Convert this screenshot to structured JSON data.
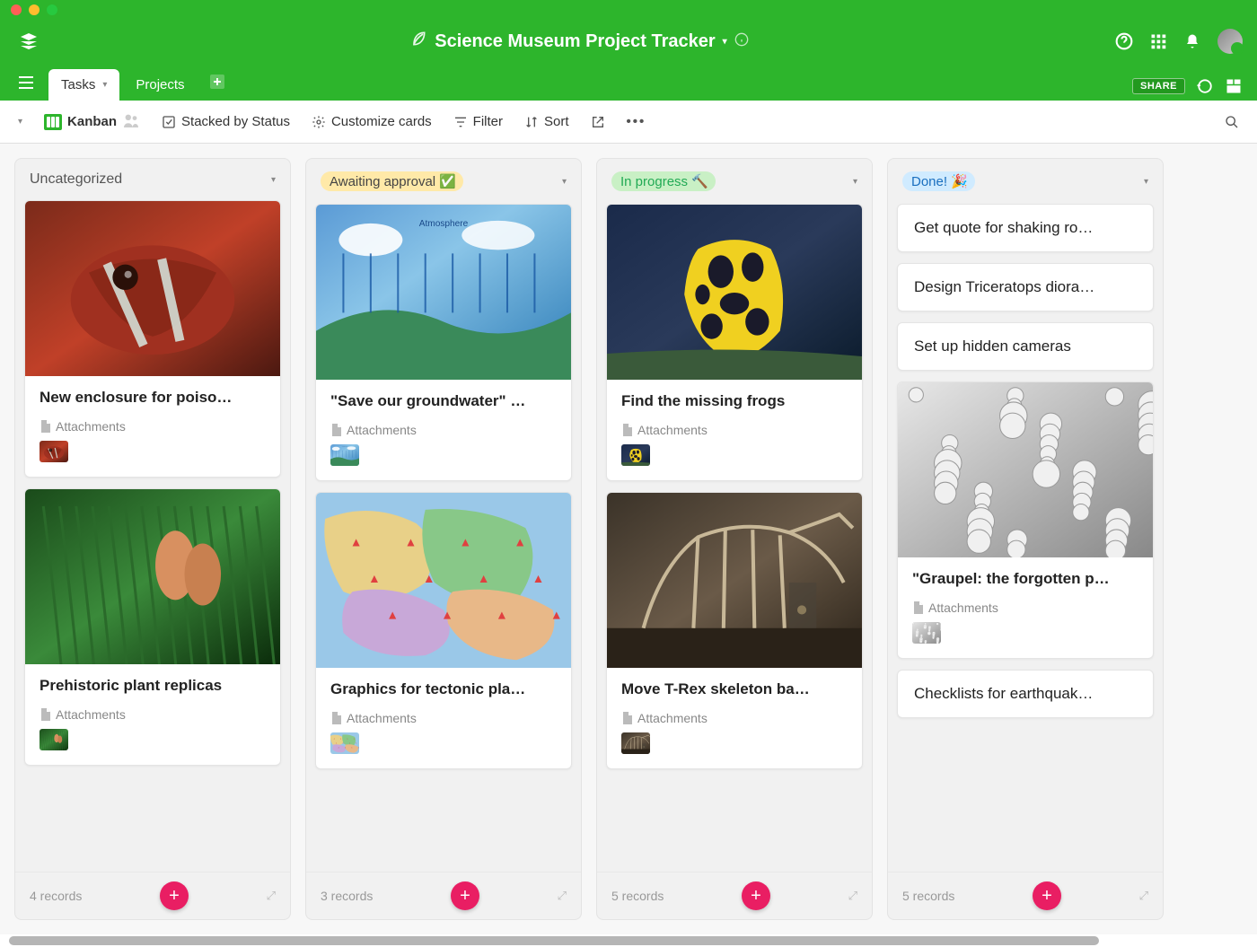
{
  "header": {
    "title": "Science Museum Project Tracker"
  },
  "tabs": {
    "active": "Tasks",
    "items": [
      "Tasks",
      "Projects"
    ]
  },
  "share_label": "SHARE",
  "toolbar": {
    "view_name": "Kanban",
    "stacked": "Stacked by Status",
    "customize": "Customize cards",
    "filter": "Filter",
    "sort": "Sort"
  },
  "attachments_label": "Attachments",
  "columns": [
    {
      "id": "uncat",
      "title": "Uncategorized",
      "pill": null,
      "record_count": "4 records",
      "cards": [
        {
          "title": "New enclosure for poiso…",
          "has_image": true,
          "has_attach": true,
          "img": "frog-red"
        },
        {
          "title": "Prehistoric plant replicas",
          "has_image": true,
          "has_attach": true,
          "img": "plant"
        }
      ]
    },
    {
      "id": "await",
      "title": "Awaiting approval",
      "emoji": "✅",
      "pill": "await",
      "record_count": "3 records",
      "cards": [
        {
          "title": "\"Save our groundwater\" …",
          "has_image": true,
          "has_attach": true,
          "img": "water-cycle"
        },
        {
          "title": "Graphics for tectonic pla…",
          "has_image": true,
          "has_attach": true,
          "img": "plates"
        }
      ]
    },
    {
      "id": "prog",
      "title": "In progress",
      "emoji": "🔨",
      "pill": "prog",
      "record_count": "5 records",
      "cards": [
        {
          "title": "Find the missing frogs",
          "has_image": true,
          "has_attach": true,
          "img": "frog-yellow"
        },
        {
          "title": "Move T-Rex skeleton ba…",
          "has_image": true,
          "has_attach": true,
          "img": "trex"
        }
      ]
    },
    {
      "id": "done",
      "title": "Done!",
      "emoji": "🎉",
      "pill": "done",
      "record_count": "5 records",
      "simple_cards": [
        "Get quote for shaking ro…",
        "Design Triceratops diora…",
        "Set up hidden cameras"
      ],
      "cards": [
        {
          "title": "\"Graupel: the forgotten p…",
          "has_image": true,
          "has_attach": true,
          "img": "graupel"
        }
      ],
      "trailing_simple": [
        "Checklists for earthquak…"
      ]
    }
  ]
}
